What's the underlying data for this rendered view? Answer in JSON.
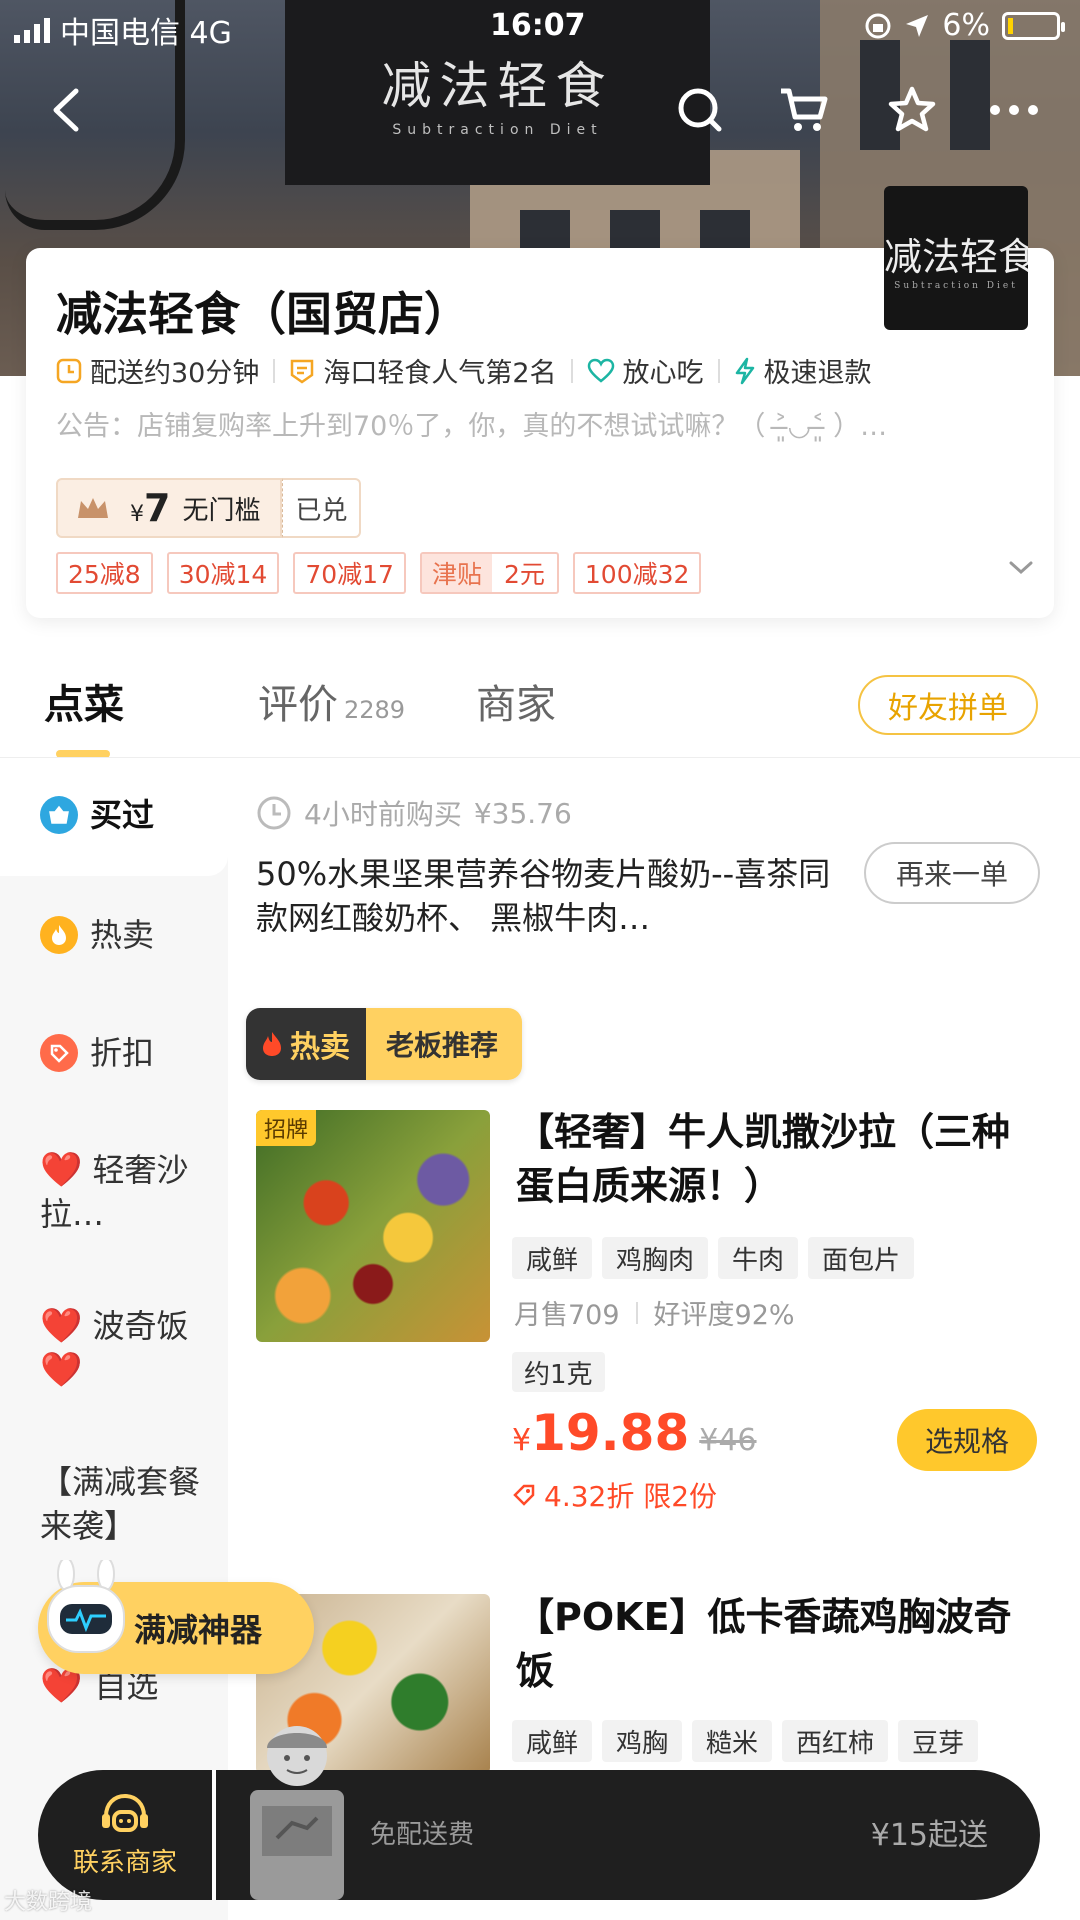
{
  "status_bar": {
    "carrier": "中国电信 4G",
    "time": "16:07",
    "battery": "6%"
  },
  "banner": {
    "sign_cn": "减法轻食",
    "sign_en": "Subtraction Diet",
    "logo_cn": "减法轻食",
    "logo_en": "Subtraction Diet"
  },
  "store": {
    "name": "减法轻食（国贸店）",
    "tags": [
      "配送约30分钟",
      "海口轻食人气第2名",
      "放心吃",
      "极速退款"
    ],
    "notice": "公告：店铺复购率上升到70％了，你，真的不想试试嘛？（ ˃̶͈◡˂̶͈ ）…",
    "coupon": {
      "currency": "¥",
      "amount": "7",
      "desc": "无门槛",
      "status": "已兑"
    },
    "promotions": [
      "25减8",
      "30减14",
      "70减17",
      "100减32"
    ],
    "subsidy": {
      "label": "津贴",
      "value": "2元"
    }
  },
  "tabs": {
    "order": "点菜",
    "reviews": "评价",
    "reviews_count": "2289",
    "merchant": "商家",
    "group_order": "好友拼单"
  },
  "sidebar": {
    "bought": "买过",
    "hot": "热卖",
    "discount": "折扣",
    "light_salad": "轻奢沙拉…",
    "poke": "波奇饭",
    "combo": "【满减套餐来袭】",
    "picks": "自选"
  },
  "bought_section": {
    "time": "4小时前购买",
    "price": "¥35.76",
    "item": "50%水果坚果营养谷物麦片酸奶--喜茶同款网红酸奶杯、 黑椒牛肉…",
    "reorder": "再来一单"
  },
  "hot_label": {
    "hot": "热卖",
    "recommend": "老板推荐"
  },
  "dishes": [
    {
      "badge": "招牌",
      "title": "【轻奢】牛人凯撒沙拉（三种蛋白质来源！）",
      "tags": [
        "咸鲜",
        "鸡胸肉",
        "牛肉",
        "面包片"
      ],
      "monthly_sales": "月售709",
      "rating": "好评度92%",
      "weight": "约1克",
      "price_symbol": "¥",
      "price": "19.88",
      "original_price": "¥46",
      "discount": "4.32折 限2份",
      "action": "选规格"
    },
    {
      "title": "【POKE】低卡香蔬鸡胸波奇饭",
      "tags": [
        "咸鲜",
        "鸡胸",
        "糙米",
        "西红柿",
        "豆芽"
      ]
    }
  ],
  "promo_float": "满减神器",
  "bottom_bar": {
    "contact": "联系商家",
    "free_delivery": "免配送费",
    "min_order": "¥15起送"
  },
  "watermark": "大数跨境",
  "colors": {
    "accent": "#ffd161",
    "price_red": "#ff4a28",
    "dark_bar": "#1f1f1f"
  }
}
